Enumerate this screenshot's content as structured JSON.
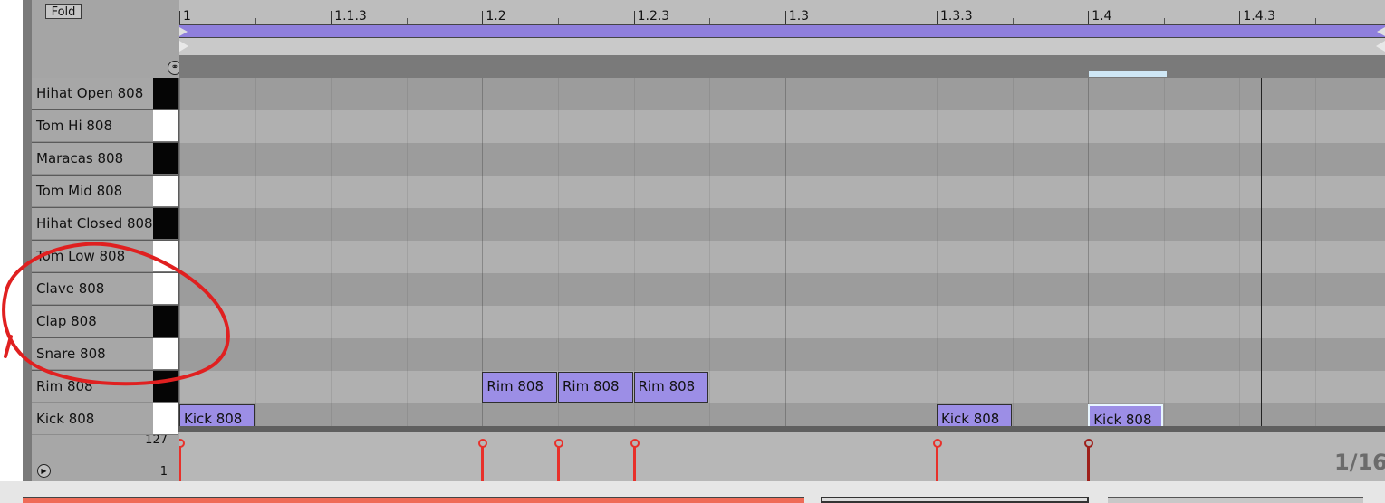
{
  "header": {
    "fold_label": "Fold",
    "headphones_icon": "headphones-icon"
  },
  "ruler": {
    "labels": [
      "1",
      "1.1.3",
      "1.2",
      "1.2.3",
      "1.3",
      "1.3.3",
      "1.4",
      "1.4.3"
    ]
  },
  "lanes": [
    {
      "name": "Hihat Open 808",
      "key": "black"
    },
    {
      "name": "Tom Hi 808",
      "key": "white"
    },
    {
      "name": "Maracas 808",
      "key": "black"
    },
    {
      "name": "Tom Mid 808",
      "key": "white"
    },
    {
      "name": "Hihat Closed 808",
      "key": "black"
    },
    {
      "name": "Tom Low 808",
      "key": "white"
    },
    {
      "name": "Clave 808",
      "key": "white"
    },
    {
      "name": "Clap 808",
      "key": "black"
    },
    {
      "name": "Snare 808",
      "key": "white"
    },
    {
      "name": "Rim 808",
      "key": "black"
    },
    {
      "name": "Kick 808",
      "key": "white"
    }
  ],
  "notes": [
    {
      "label": "Kick 808",
      "lane": "Kick 808",
      "start": "1",
      "selected": false
    },
    {
      "label": "Rim 808",
      "lane": "Rim 808",
      "start": "1.2",
      "selected": false
    },
    {
      "label": "Rim 808",
      "lane": "Rim 808",
      "start": "1.2.2",
      "selected": false
    },
    {
      "label": "Rim 808",
      "lane": "Rim 808",
      "start": "1.2.3",
      "selected": false
    },
    {
      "label": "Kick 808",
      "lane": "Kick 808",
      "start": "1.3.3",
      "selected": false
    },
    {
      "label": "Kick 808",
      "lane": "Kick 808",
      "start": "1.4",
      "selected": true
    }
  ],
  "velocity": {
    "max_label": "127",
    "min_label": "1",
    "play_icon": "play-icon"
  },
  "grid_label": "1/16",
  "colors": {
    "note_fill": "#9c8ee6",
    "loop_bar": "#8f7fdc",
    "velocity_stem": "#e8302a",
    "annotation": "#e02020"
  }
}
